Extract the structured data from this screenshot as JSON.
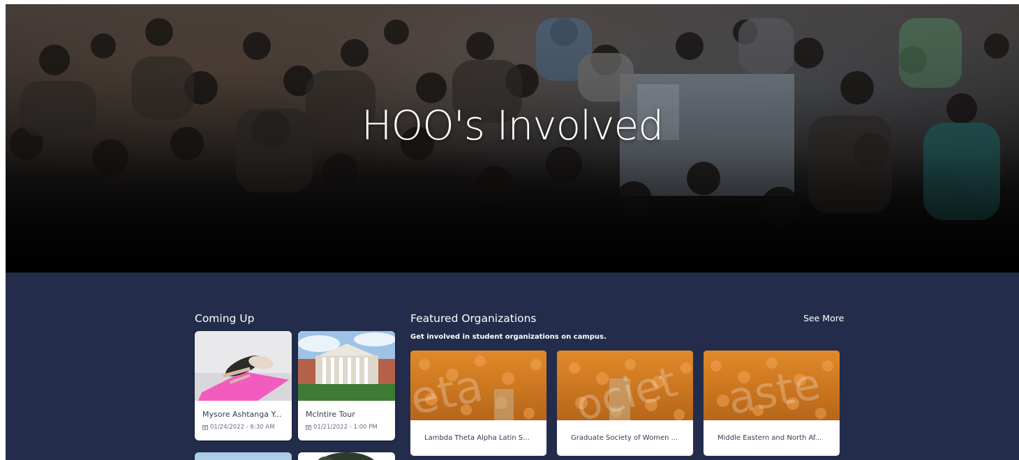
{
  "hero": {
    "title": "HOO's Involved"
  },
  "coming_up": {
    "title": "Coming Up",
    "events": [
      {
        "name": "Mysore Ashtanga Y...",
        "date": "01/24/2022 - 6:30 AM"
      },
      {
        "name": "McIntire Tour",
        "date": "01/21/2022 - 1:00 PM"
      }
    ]
  },
  "featured": {
    "title": "Featured Organizations",
    "subtitle": "Get involved in student organizations on campus.",
    "see_more": "See More",
    "organizations": [
      {
        "name": "Lambda Theta Alpha Latin S...",
        "watermark": "eta"
      },
      {
        "name": "Graduate Society of Women ...",
        "watermark": "ociet"
      },
      {
        "name": "Middle Eastern and North Af...",
        "watermark": "aste"
      }
    ]
  },
  "colors": {
    "navy": "#232d4b",
    "orange": "#e08a2a",
    "white": "#ffffff"
  }
}
